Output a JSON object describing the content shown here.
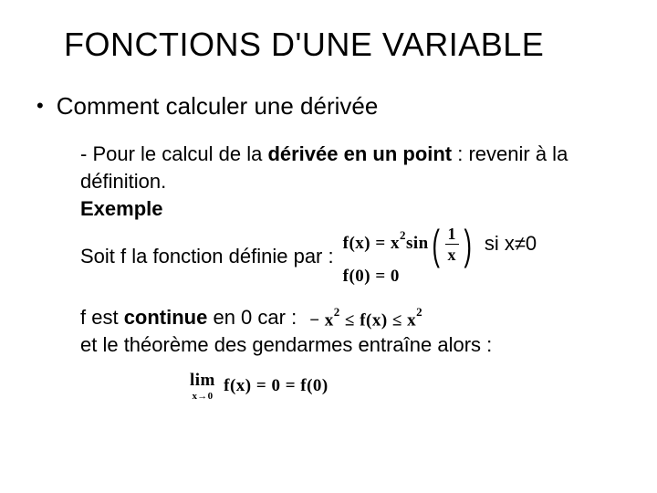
{
  "title": "FONCTIONS D'UNE VARIABLE",
  "bullet": "Comment calculer une dérivée",
  "body": {
    "line1_pre": "- Pour le calcul de la ",
    "line1_bold": "dérivée en un point",
    "line1_post": " : revenir à la définition.",
    "exemple_label": "Exemple",
    "soit_line": "Soit f la fonction définie par :",
    "si_cond": "si x≠0",
    "continue_pre": "f est ",
    "continue_bold": "continue",
    "continue_post": " en 0 car :",
    "gendarmes": "et le théorème des gendarmes entraîne alors :"
  },
  "math": {
    "eq1_lhs": "f(x)",
    "eq1_eq": "=",
    "eq1_x2": "x",
    "eq1_exp": "2",
    "eq1_sin": "sin",
    "frac_num": "1",
    "frac_den": "x",
    "eq2": "f(0) = 0",
    "ineq_a_sign": "−",
    "ineq_a": "x",
    "ineq_a_exp": "2",
    "ineq_le1": "≤",
    "ineq_mid": "f(x)",
    "ineq_le2": "≤",
    "ineq_c": "x",
    "ineq_c_exp": "2",
    "lim_word": "lim",
    "lim_sub": "x→0",
    "lim_rhs": "f(x) = 0 = f(0)"
  }
}
